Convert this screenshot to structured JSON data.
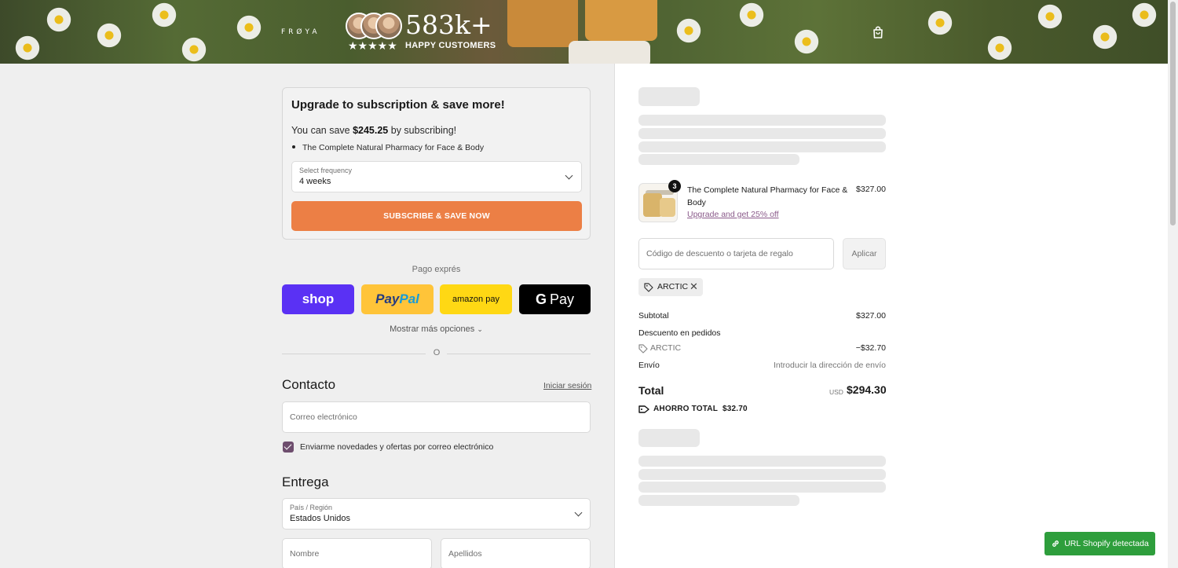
{
  "header": {
    "brand": "FRØYA",
    "social_count": "583k+",
    "stars": "★★★★★",
    "social_label": "HAPPY CUSTOMERS",
    "cart_icon": "shopping-bag-icon"
  },
  "upsell": {
    "title": "Upgrade to subscription & save more!",
    "save_prefix": "You can save ",
    "save_amount": "$245.25",
    "save_suffix": " by subscribing!",
    "item": "The Complete Natural Pharmacy for Face & Body",
    "frequency_label": "Select frequency",
    "frequency_value": "4 weeks",
    "button": "SUBSCRIBE & SAVE NOW",
    "accent": "#ec7f45"
  },
  "express": {
    "label": "Pago exprés",
    "shop": "shop",
    "paypal_1": "Pay",
    "paypal_2": "Pal",
    "amazon": "amazon pay",
    "gpay_g": "G",
    "gpay": "Pay",
    "more": "Mostrar más opciones",
    "or": "O"
  },
  "contact": {
    "heading": "Contacto",
    "login": "Iniciar sesión",
    "email_placeholder": "Correo electrónico",
    "newsletter": "Enviarme novedades y ofertas por correo electrónico",
    "newsletter_checked": true
  },
  "delivery": {
    "heading": "Entrega",
    "country_label": "País / Región",
    "country_value": "Estados Unidos",
    "first_name_placeholder": "Nombre",
    "last_name_placeholder": "Apellidos"
  },
  "summary": {
    "product_name": "The Complete Natural Pharmacy for Face & Body",
    "product_upgrade": "Upgrade and get 25% off",
    "product_price": "$327.00",
    "quantity": "3",
    "discount_placeholder": "Código de descuento o tarjeta de regalo",
    "apply": "Aplicar",
    "code": "ARCTIC",
    "subtotal_label": "Subtotal",
    "subtotal_value": "$327.00",
    "order_discount_label": "Descuento en pedidos",
    "discount_code": "ARCTIC",
    "discount_value": "−$32.70",
    "shipping_label": "Envío",
    "shipping_value": "Introducir la dirección de envío",
    "total_label": "Total",
    "currency": "USD",
    "total_value": "$294.30",
    "savings_label": "AHORRO TOTAL",
    "savings_value": "$32.70"
  },
  "badge": {
    "label": "URL Shopify detectada",
    "color": "#2e9e3c"
  }
}
